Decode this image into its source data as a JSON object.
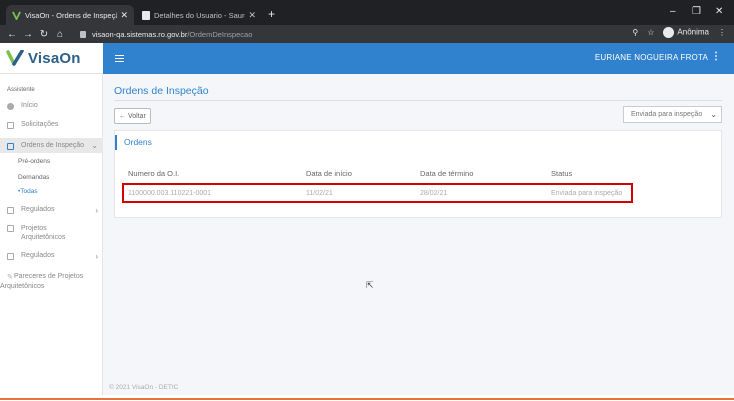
{
  "browser": {
    "tabs": [
      {
        "title": "VisaOn - Ordens de Inspeção",
        "close": "✕"
      },
      {
        "title": "Detalhes do Usuario - Sauron.Ge",
        "close": "✕"
      }
    ],
    "new_tab": "+",
    "url_host": "visaon-qa.sistemas.ro.gov.br",
    "url_path": "/OrdemDeInspecao",
    "profile": "Anônima",
    "icons": [
      "back-icon",
      "forward-icon",
      "reload-icon",
      "home-icon",
      "lock-icon",
      "zoom-icon",
      "star-icon",
      "menu-icon"
    ]
  },
  "brand": {
    "name": "VisaOn"
  },
  "topbar": {
    "user": "EURIANE NOGUEIRA FROTA",
    "menu": "⋮"
  },
  "sidebar": {
    "section": "Assistente",
    "items": [
      {
        "label": "Início"
      },
      {
        "label": "Solicitações"
      },
      {
        "label": "Ordens de Inspeção"
      },
      {
        "label": "Regulados"
      },
      {
        "label": "Projetos Arquitetônicos"
      },
      {
        "label": "Regulados"
      },
      {
        "label": "Pareceres de Projetos Arquitetônicos"
      }
    ],
    "subitems": [
      {
        "label": "Pré-ordens"
      },
      {
        "label": "Demandas"
      },
      {
        "label": "•Todas"
      }
    ]
  },
  "main": {
    "title": "Ordens de Inspeção",
    "back_label": "Voltar",
    "status_filter": "Enviada para inspeção",
    "card_title": "Ordens",
    "columns": [
      "Numero da O.I.",
      "Data de início",
      "Data de término",
      "Status"
    ],
    "rows": [
      {
        "numero": "1100000.003.110221-0001",
        "inicio": "11/02/21",
        "termino": "28/02/21",
        "status": "Enviada para inspeção"
      }
    ]
  },
  "footer": {
    "text": "© 2021 VisaOn - DETIC"
  },
  "colors": {
    "primary": "#3182ce",
    "highlight": "#d40000",
    "accent_strip": "#e8723c"
  }
}
